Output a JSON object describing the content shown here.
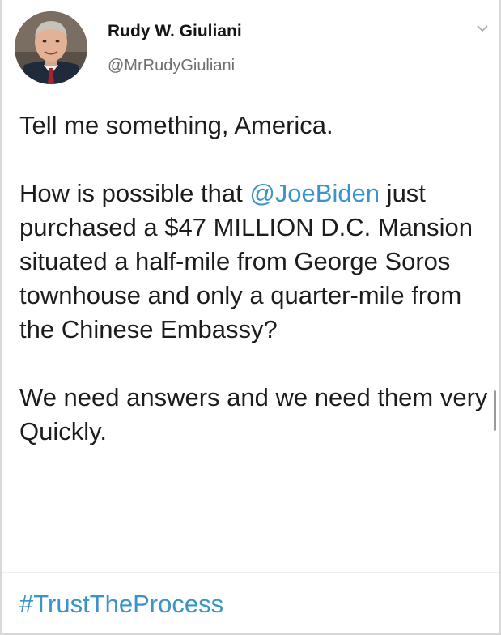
{
  "author": {
    "name": "Rudy W. Giuliani",
    "handle": "@MrRudyGiuliani",
    "avatar_icon": "profile-photo"
  },
  "menu": {
    "icon": "chevron-down-icon"
  },
  "tweet": {
    "line1": "Tell me something, America.",
    "para2_before": "How is possible that ",
    "mention": "@JoeBiden",
    "para2_after": " just purchased a $47 MILLION D.C. Mansion situated a half-mile from George Soros townhouse and only a quarter-mile from the Chinese Embassy?",
    "para3": "We need answers and we need them very Quickly.",
    "hashtag": "#TrustTheProcess"
  },
  "colors": {
    "link": "#3b94c9",
    "text": "#1c1c1c",
    "handle": "#6f6f6f"
  }
}
